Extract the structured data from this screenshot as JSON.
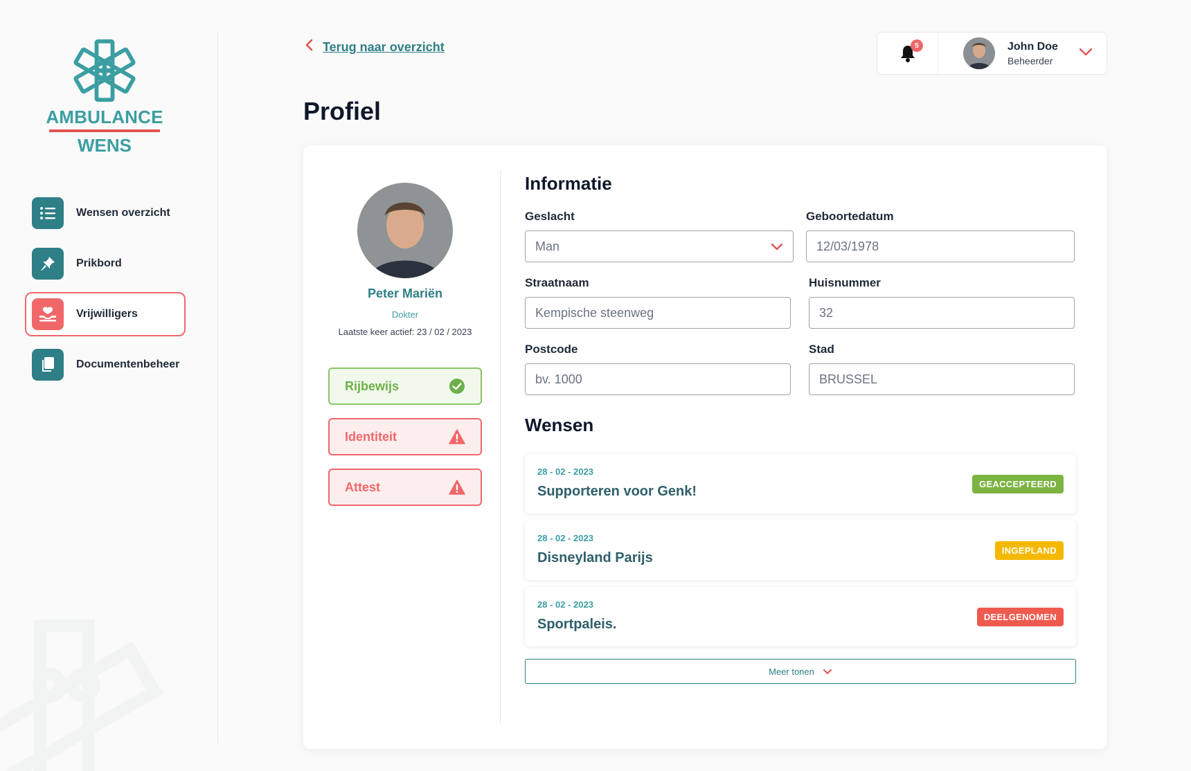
{
  "brand": {
    "line1": "AMBULANCE",
    "line2": "WENS",
    "color_primary": "#3b9ea2",
    "color_accent": "#e35450"
  },
  "sidebar": {
    "items": [
      {
        "label": "Wensen overzicht",
        "icon": "list-icon",
        "active": false
      },
      {
        "label": "Prikbord",
        "icon": "pin-icon",
        "active": false
      },
      {
        "label": "Vrijwilligers",
        "icon": "volunteers-icon",
        "active": true
      },
      {
        "label": "Documentenbeheer",
        "icon": "documents-icon",
        "active": false
      }
    ]
  },
  "topbar": {
    "back_label": "Terug naar overzicht",
    "notifications_count": "5",
    "user_name": "John Doe",
    "user_role": "Beheerder"
  },
  "page": {
    "title": "Profiel"
  },
  "profile": {
    "name": "Peter Mariën",
    "role": "Dokter",
    "last_active": "Laatste keer actief: 23 / 02 / 2023",
    "documents": [
      {
        "label": "Rijbewijs",
        "status": "ok"
      },
      {
        "label": "Identiteit",
        "status": "warning"
      },
      {
        "label": "Attest",
        "status": "warning"
      }
    ]
  },
  "info": {
    "title": "Informatie",
    "gender_label": "Geslacht",
    "gender_value": "Man",
    "birthdate_label": "Geboortedatum",
    "birthdate_placeholder": "12/03/1978",
    "street_label": "Straatnaam",
    "street_placeholder": "Kempische steenweg",
    "number_label": "Huisnummer",
    "number_placeholder": "32",
    "postcode_label": "Postcode",
    "postcode_placeholder": "bv. 1000",
    "city_label": "Stad",
    "city_placeholder": "BRUSSEL"
  },
  "wishes": {
    "title": "Wensen",
    "items": [
      {
        "date": "28 - 02 - 2023",
        "title": "Supporteren voor Genk!",
        "status": "GEACCEPTEERD",
        "color": "#7cb342"
      },
      {
        "date": "28 - 02 - 2023",
        "title": "Disneyland Parijs",
        "status": "INGEPLAND",
        "color": "#f5b800"
      },
      {
        "date": "28 - 02 - 2023",
        "title": "Sportpaleis.",
        "status": "DEELGENOMEN",
        "color": "#ef5a4f"
      }
    ],
    "more_label": "Meer tonen"
  }
}
